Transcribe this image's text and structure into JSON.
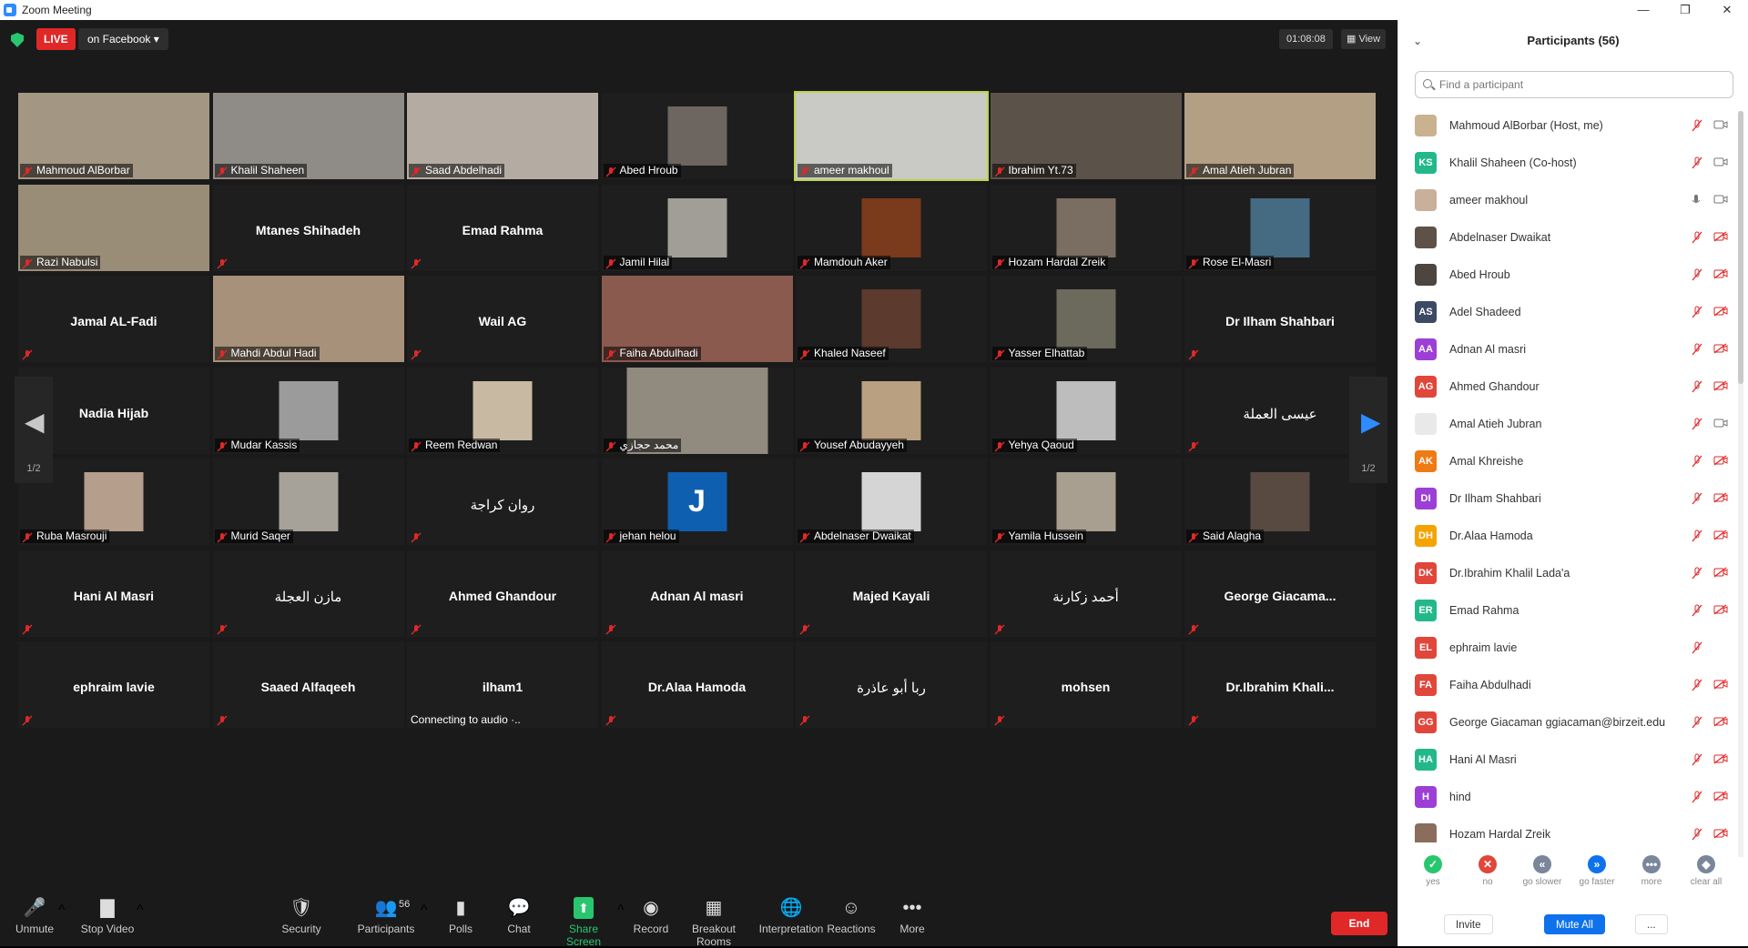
{
  "window": {
    "title": "Zoom Meeting",
    "buttons": [
      "—",
      "❐",
      "✕"
    ]
  },
  "topbar": {
    "live_label": "LIVE",
    "live_target": "on Facebook",
    "timer": "01:08:08",
    "view_label": "View"
  },
  "grid": {
    "page_left": "1/2",
    "page_right": "1/2",
    "tiles": [
      {
        "name": "Mahmoud AlBorbar",
        "video": true,
        "bg": "#a39683"
      },
      {
        "name": "Khalil Shaheen",
        "video": true,
        "bg": "#8f8b86"
      },
      {
        "name": "Saad Abdelhadi",
        "video": true,
        "bg": "#b4aca3"
      },
      {
        "name": "Abed Hroub",
        "video": true,
        "bg": "#6c6560",
        "small": true
      },
      {
        "name": "ameer makhoul",
        "video": true,
        "bg": "#c9c9c6",
        "active": true
      },
      {
        "name": "Ibrahim Yt.73",
        "video": true,
        "bg": "#5b524a"
      },
      {
        "name": "Amal Atieh Jubran",
        "video": true,
        "bg": "#b29f84"
      },
      {
        "name": "Razi Nabulsi",
        "video": true,
        "bg": "#9a8d78"
      },
      {
        "name": "Mtanes Shihadeh",
        "video": false
      },
      {
        "name": "Emad Rahma",
        "video": false
      },
      {
        "name": "Jamil Hilal",
        "video": true,
        "bg": "#a09e97",
        "small": true
      },
      {
        "name": "Mamdouh Aker",
        "video": true,
        "bg": "#7a3a1c",
        "small": true
      },
      {
        "name": "Hozam Hardal Zreik",
        "video": true,
        "bg": "#7a6d62",
        "small": true
      },
      {
        "name": "Rose El-Masri",
        "video": true,
        "bg": "#456b82",
        "small": true
      },
      {
        "name": "Jamal AL-Fadi",
        "video": false
      },
      {
        "name": "Mahdi Abdul Hadi",
        "video": true,
        "bg": "#a7917a"
      },
      {
        "name": "Wail AG",
        "video": false
      },
      {
        "name": "Faiha Abdulhadi",
        "video": true,
        "bg": "#8a5a4f"
      },
      {
        "name": "Khaled Naseef",
        "video": true,
        "bg": "#5c3a2e",
        "small": true
      },
      {
        "name": "Yasser Elhattab",
        "video": true,
        "bg": "#6c6a5c",
        "small": true
      },
      {
        "name": "Dr Ilham Shahbari",
        "video": false
      },
      {
        "name": "Nadia Hijab",
        "video": false
      },
      {
        "name": "Mudar Kassis",
        "video": true,
        "bg": "#9b9b9b",
        "small": true
      },
      {
        "name": "Reem Redwan",
        "video": true,
        "bg": "#c8b9a3",
        "small": true
      },
      {
        "name": "محمد حجازي",
        "video": true,
        "bg": "#918a7f",
        "mid": true
      },
      {
        "name": "Yousef Abudayyeh",
        "video": true,
        "bg": "#b8a080",
        "small": true
      },
      {
        "name": "Yehya Qaoud",
        "video": true,
        "bg": "#bdbdbd",
        "small": true
      },
      {
        "name": "عيسى العملة",
        "video": false,
        "arabic": true
      },
      {
        "name": "Ruba Masrouji",
        "video": true,
        "bg": "#b59e8c",
        "small": true
      },
      {
        "name": "Murid Saqer",
        "video": true,
        "bg": "#a6a29a",
        "small": true
      },
      {
        "name": "روان كراجة",
        "video": false,
        "arabic": true
      },
      {
        "name": "jehan helou",
        "video": true,
        "bg": "#0e5fb0",
        "small": true,
        "initial": "J"
      },
      {
        "name": "Abdelnaser Dwaikat",
        "video": true,
        "bg": "#d5d5d5",
        "small": true
      },
      {
        "name": "Yamila Hussein",
        "video": true,
        "bg": "#a89f90",
        "small": true
      },
      {
        "name": "Said Alagha",
        "video": true,
        "bg": "#584a40",
        "small": true
      },
      {
        "name": "Hani Al Masri",
        "video": false
      },
      {
        "name": "مازن العجلة",
        "video": false,
        "arabic": true
      },
      {
        "name": "Ahmed Ghandour",
        "video": false
      },
      {
        "name": "Adnan Al masri",
        "video": false
      },
      {
        "name": "Majed Kayali",
        "video": false
      },
      {
        "name": "أحمد زكارنة",
        "video": false,
        "arabic": true
      },
      {
        "name": "George  Giacama...",
        "video": false
      },
      {
        "name": "ephraim lavie",
        "video": false
      },
      {
        "name": "Saaed Alfaqeeh",
        "video": false
      },
      {
        "name": "ilham1",
        "video": false,
        "status": "Connecting to audio ·.."
      },
      {
        "name": "Dr.Alaa Hamoda",
        "video": false
      },
      {
        "name": "ربا أبو عاذرة",
        "video": false,
        "arabic": true
      },
      {
        "name": "mohsen",
        "video": false
      },
      {
        "name": "Dr.Ibrahim  Khali...",
        "video": false
      }
    ]
  },
  "toolbar": {
    "items": [
      {
        "key": "mute",
        "label": "Unmute",
        "icon": "🎤"
      },
      {
        "key": "video",
        "label": "Stop Video",
        "icon": "▇"
      },
      {
        "key": "security",
        "label": "Security",
        "icon": "🛡"
      },
      {
        "key": "participants",
        "label": "Participants",
        "icon": "👥",
        "count": "56"
      },
      {
        "key": "polls",
        "label": "Polls",
        "icon": "▮"
      },
      {
        "key": "chat",
        "label": "Chat",
        "icon": "💬"
      },
      {
        "key": "share",
        "label": "Share Screen",
        "icon": "⬆"
      },
      {
        "key": "record",
        "label": "Record",
        "icon": "◉"
      },
      {
        "key": "breakout",
        "label": "Breakout Rooms",
        "icon": "▦"
      },
      {
        "key": "interp",
        "label": "Interpretation",
        "icon": "🌐"
      },
      {
        "key": "reactions",
        "label": "Reactions",
        "icon": "☺"
      },
      {
        "key": "more",
        "label": "More",
        "icon": "•••"
      }
    ],
    "end_label": "End"
  },
  "panel": {
    "title": "Participants (56)",
    "search_placeholder": "Find a participant",
    "participants": [
      {
        "name": "Mahmoud AlBorbar (Host, me)",
        "initials": "",
        "color": "#c9b28f",
        "video_on": true
      },
      {
        "name": "Khalil Shaheen (Co-host)",
        "initials": "KS",
        "color": "#23b88a",
        "video_on": true
      },
      {
        "name": "ameer makhoul",
        "initials": "",
        "color": "#c8b09a",
        "video_on": true,
        "mic_on": true
      },
      {
        "name": "Abdelnaser Dwaikat",
        "initials": "",
        "color": "#5d5148"
      },
      {
        "name": "Abed Hroub",
        "initials": "",
        "color": "#4c4540"
      },
      {
        "name": "Adel Shadeed",
        "initials": "AS",
        "color": "#3c4b63"
      },
      {
        "name": "Adnan Al masri",
        "initials": "AA",
        "color": "#9c3fd6"
      },
      {
        "name": "Ahmed Ghandour",
        "initials": "AG",
        "color": "#e0463a"
      },
      {
        "name": "Amal Atieh Jubran",
        "initials": "",
        "color": "#e9e9e9",
        "video_on": true
      },
      {
        "name": "Amal Khreishe",
        "initials": "AK",
        "color": "#f07a14"
      },
      {
        "name": "Dr Ilham Shahbari",
        "initials": "DI",
        "color": "#9c3fd6"
      },
      {
        "name": "Dr.Alaa Hamoda",
        "initials": "DH",
        "color": "#f5a300"
      },
      {
        "name": "Dr.Ibrahim Khalil Lada'a",
        "initials": "DK",
        "color": "#e0463a"
      },
      {
        "name": "Emad Rahma",
        "initials": "ER",
        "color": "#23b88a"
      },
      {
        "name": "ephraim lavie",
        "initials": "EL",
        "color": "#e0463a",
        "no_cam": true
      },
      {
        "name": "Faiha Abdulhadi",
        "initials": "FA",
        "color": "#e0463a"
      },
      {
        "name": "George Giacaman ggiacaman@birzeit.edu",
        "initials": "GG",
        "color": "#e0463a"
      },
      {
        "name": "Hani Al Masri",
        "initials": "HA",
        "color": "#23b88a"
      },
      {
        "name": "hind",
        "initials": "H",
        "color": "#9c3fd6"
      },
      {
        "name": "Hozam Hardal Zreik",
        "initials": "",
        "color": "#8a6d5d"
      }
    ],
    "feedback": [
      {
        "label": "yes",
        "color": "#28c76f",
        "glyph": "✓"
      },
      {
        "label": "no",
        "color": "#e0463a",
        "glyph": "✕"
      },
      {
        "label": "go slower",
        "color": "#7a869a",
        "glyph": "«"
      },
      {
        "label": "go faster",
        "color": "#0e72ed",
        "glyph": "»"
      },
      {
        "label": "more",
        "color": "#7a869a",
        "glyph": "•••"
      },
      {
        "label": "clear all",
        "color": "#7a869a",
        "glyph": "◆"
      }
    ],
    "invite_label": "Invite",
    "mute_all_label": "Mute All",
    "more_label": "..."
  }
}
